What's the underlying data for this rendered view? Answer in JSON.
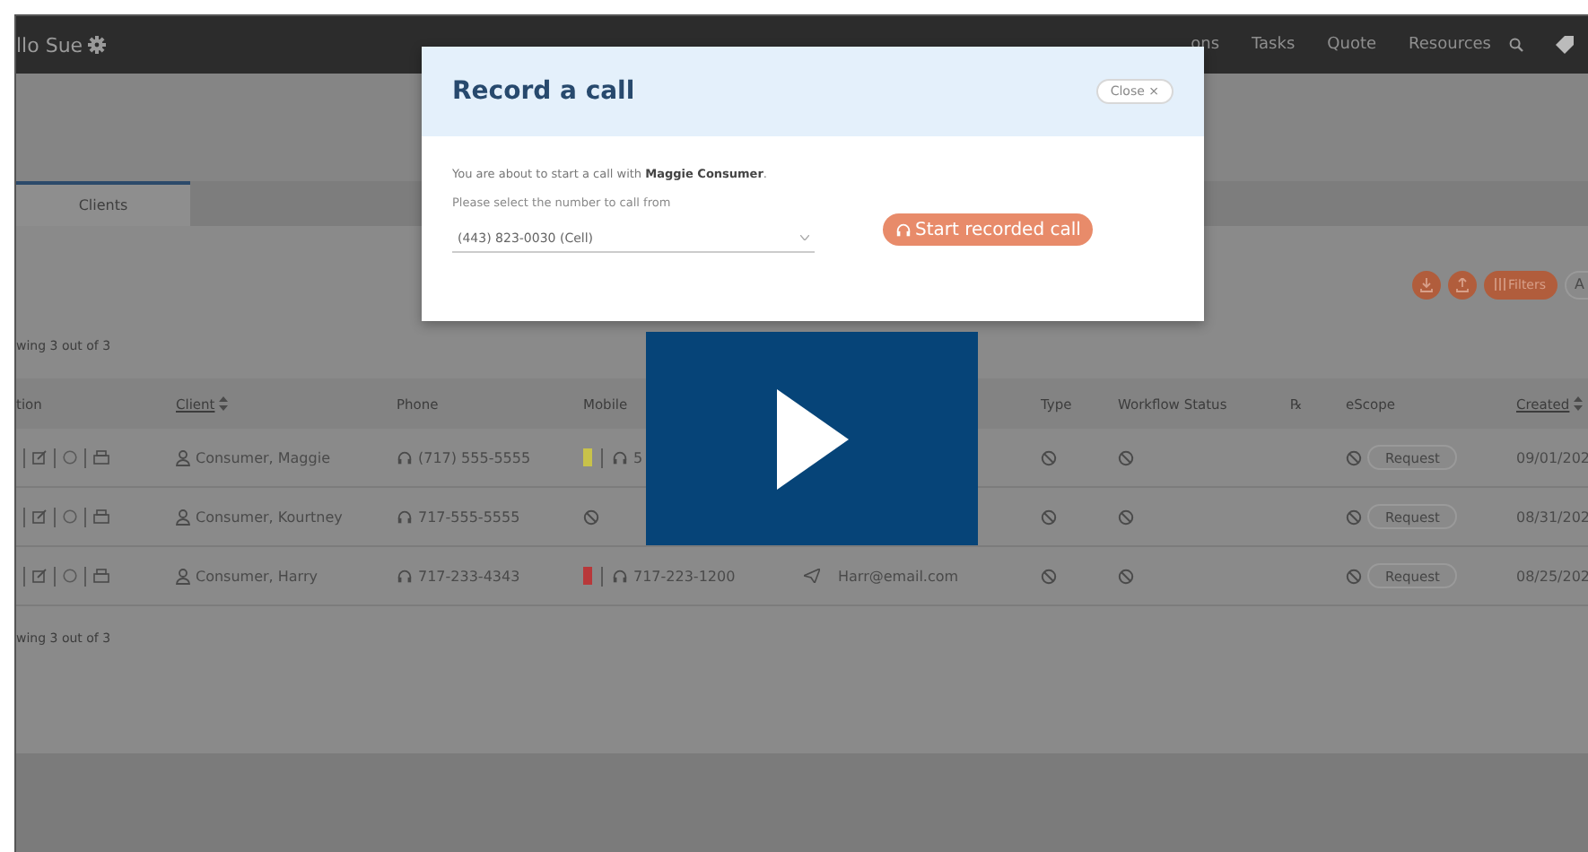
{
  "nav": {
    "greeting": "llo Sue",
    "items": [
      "ons",
      "Tasks",
      "Quote",
      "Resources"
    ]
  },
  "tabs": [
    {
      "label": "Clients",
      "selected": true
    }
  ],
  "result_count_top": "wing 3 out of 3",
  "toolbar": {
    "filters": "Filters",
    "cut_button": "A"
  },
  "table": {
    "columns": [
      {
        "label": "tion",
        "sortable": false
      },
      {
        "label": "Client",
        "sortable": true
      },
      {
        "label": "Phone",
        "sortable": false
      },
      {
        "label": "Mobile",
        "sortable": false
      },
      {
        "label": "Type",
        "sortable": false
      },
      {
        "label": "Workflow Status",
        "sortable": false
      },
      {
        "label": "℞",
        "sortable": false
      },
      {
        "label": "eScope",
        "sortable": false
      },
      {
        "label": "Created",
        "sortable": true
      }
    ],
    "rows": [
      {
        "client": "Consumer, Maggie",
        "phone": "(717) 555-5555",
        "mobile": {
          "kind": "number",
          "color": "#c8c24a",
          "number": "5"
        },
        "email": "",
        "escope": "Request",
        "created": "09/01/202"
      },
      {
        "client": "Consumer, Kourtney",
        "phone": "717-555-5555",
        "mobile": {
          "kind": "none"
        },
        "email": "",
        "escope": "Request",
        "created": "08/31/202"
      },
      {
        "client": "Consumer, Harry",
        "phone": "717-233-4343",
        "mobile": {
          "kind": "number",
          "color": "#b8383a",
          "number": "717-223-1200"
        },
        "email": "Harr@email.com",
        "escope": "Request",
        "created": "08/25/202"
      }
    ]
  },
  "result_count_bottom": "wing 3 out of 3",
  "modal": {
    "title": "Record a call",
    "close": "Close ×",
    "intro": "You are about to start a call with **Maggie Consumer**.",
    "select_label": "Please select the number to call from",
    "select_value": "(443) 823-0030 (Cell)",
    "start_button": "Start recorded call"
  },
  "video": {
    "paused": true
  }
}
